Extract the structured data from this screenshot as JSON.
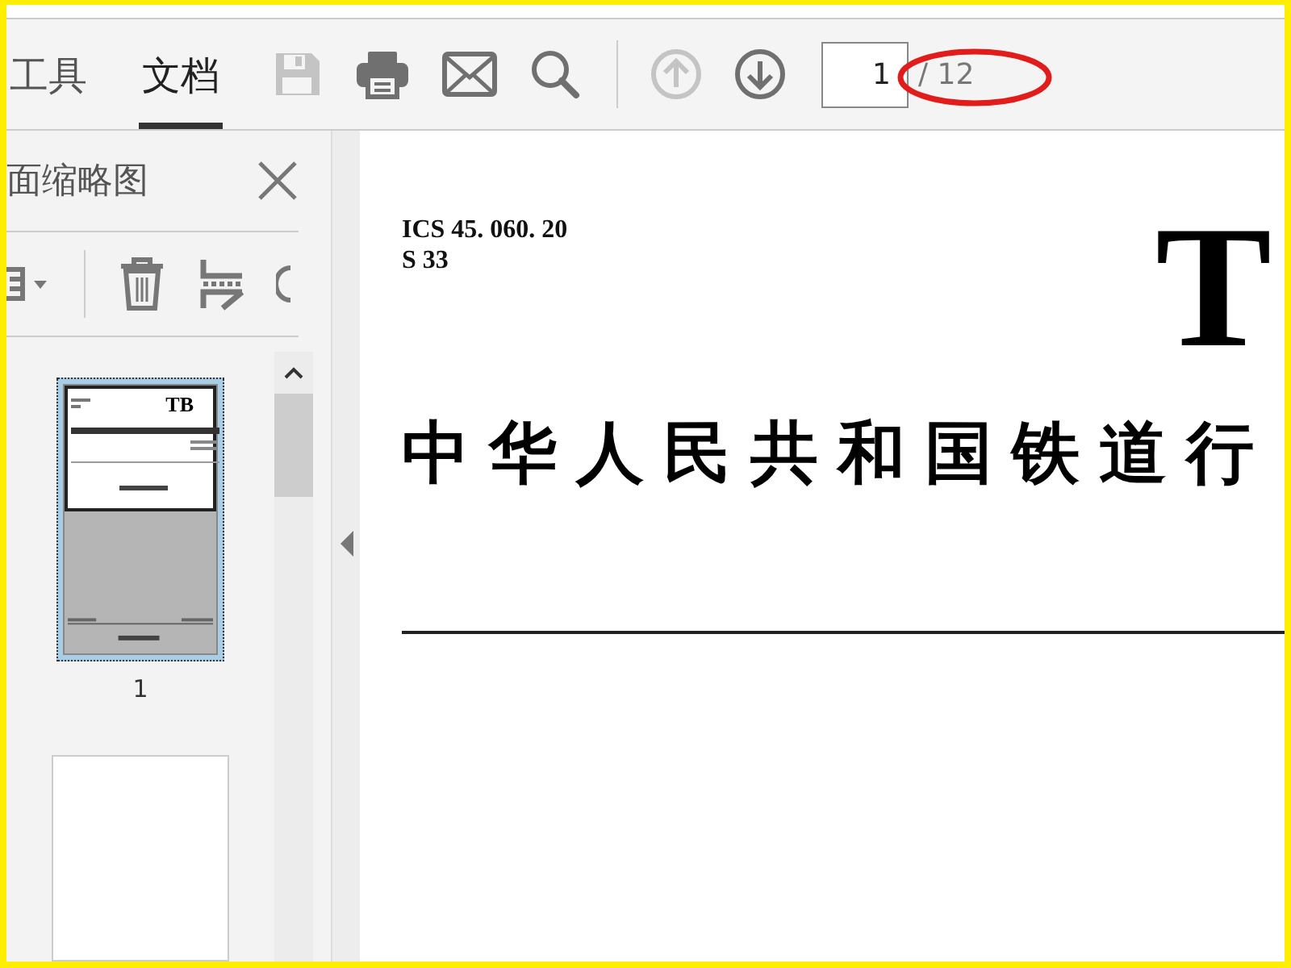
{
  "toolbar": {
    "tabs": [
      {
        "label": "工具",
        "selected": false
      },
      {
        "label": "文档",
        "selected": true
      }
    ],
    "tools": [
      {
        "kind": "save",
        "disabled": true
      },
      {
        "kind": "print",
        "disabled": false
      },
      {
        "kind": "mail",
        "disabled": false
      },
      {
        "kind": "search",
        "disabled": false
      },
      {
        "kind": "divider"
      },
      {
        "kind": "up",
        "disabled": true
      },
      {
        "kind": "down",
        "disabled": false
      }
    ],
    "page_nav": {
      "current": "1",
      "total": "/ 12"
    }
  },
  "sidebar": {
    "title": "面缩略图",
    "thumbnails": [
      {
        "code": "TB",
        "label": "1",
        "selected": true
      },
      {
        "selected": false
      }
    ]
  },
  "document": {
    "header_lines": [
      "ICS 45. 060. 20",
      "S 33"
    ],
    "code": "T",
    "title": "中华人民共和国铁道行"
  }
}
